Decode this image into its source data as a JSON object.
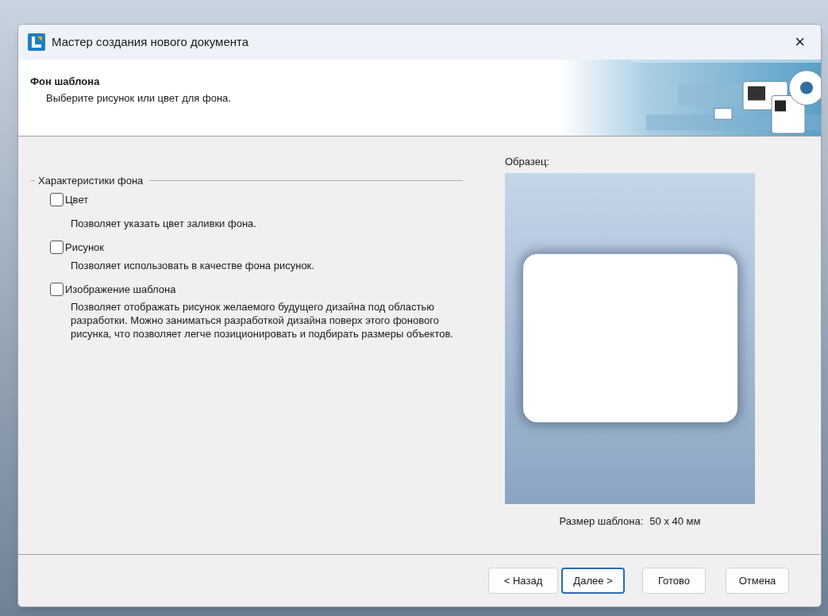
{
  "window": {
    "title": "Мастер создания нового документа",
    "close": "×"
  },
  "header": {
    "title": "Фон шаблона",
    "subtitle": "Выберите рисунок или цвет для фона."
  },
  "group": {
    "title": "Характеристики фона",
    "options": [
      {
        "label": "Цвет",
        "checked": false,
        "description": "Позволяет указать цвет заливки фона."
      },
      {
        "label": "Рисунок",
        "checked": false,
        "description": "Позволяет использовать в качестве фона рисунок."
      },
      {
        "label": "Изображение шаблона",
        "checked": false,
        "description": "Позволяет отображать рисунок желаемого будущего дизайна под областью разработки. Можно заниматься разработкой дизайна поверх этого фонового рисунка, что позволяет легче позиционировать и подбирать размеры объектов."
      }
    ]
  },
  "preview": {
    "label": "Образец:",
    "size_label": "Размер шаблона:",
    "size_value": "50 x 40 мм"
  },
  "buttons": [
    {
      "label": "< Назад",
      "default": false
    },
    {
      "label": "Далее >",
      "default": true
    },
    {
      "label": "Готово",
      "default": false
    },
    {
      "label": "Отмена",
      "default": false
    }
  ]
}
